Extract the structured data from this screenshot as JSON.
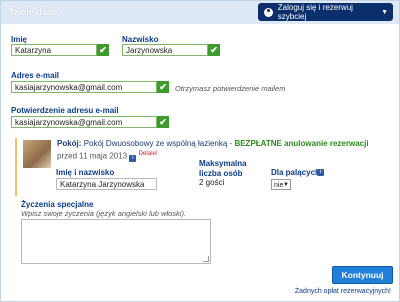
{
  "header": {
    "title": "Twoje dane",
    "login_label": "Zaloguj się i rezerwuj szybciej"
  },
  "form": {
    "first_name": {
      "label": "Imię",
      "value": "Katarzyna"
    },
    "last_name": {
      "label": "Nazwisko",
      "value": "Jarzynowska"
    },
    "email": {
      "label": "Adres e-mail",
      "value": "kasiajarzynowska@gmail.com",
      "hint": "Otrzymasz potwierdzenie mailem"
    },
    "email_confirm": {
      "label": "Potwierdzenie adresu e-mail",
      "value": "kasiajarzynowska@gmail.com"
    },
    "check_glyph": "✔"
  },
  "room": {
    "label": "Pokój:",
    "name": "Pokój Dwuosobowy ze wspólną łazienką",
    "free_cancel": "BEZPŁATNE anulowanie rezerwacji",
    "deadline": "przed 11 maja 2013",
    "info_glyph": "i",
    "details_link": "Detale!",
    "guest_label": "Imię i nazwisko",
    "guest_value": "Katarzyna Jarzynowska",
    "max_label": "Maksymalna liczba osób",
    "max_value": "2 gości",
    "smoking_label": "Dla palących",
    "smoking_value": "nie"
  },
  "wishes": {
    "label": "Życzenia specjalne",
    "hint": "Wpisz swoje życzenia (język angielski lub włoski).",
    "value": ""
  },
  "submit_label": "Kontynuuj",
  "footer_note": "Żadnych opłat rezerwacyjnych!",
  "colors": {
    "header": "#dfe9f5",
    "login": "#0a2f6b",
    "check": "#3f9b2c",
    "submit": "#1f7fd9",
    "label": "#0b3d8c"
  }
}
